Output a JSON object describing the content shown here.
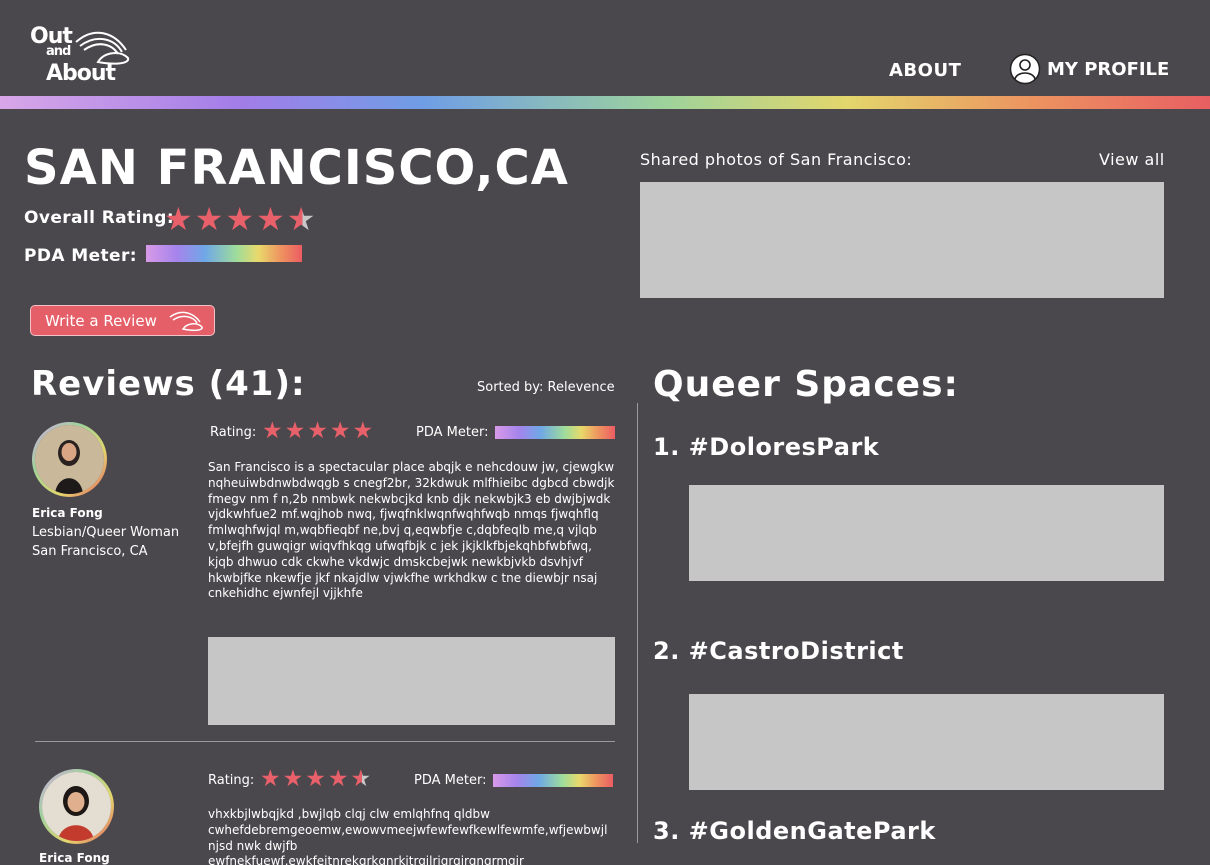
{
  "header": {
    "logo": {
      "line1": "Out",
      "line2": "and",
      "line3": "About"
    },
    "nav_about": "ABOUT",
    "nav_profile": "MY PROFILE"
  },
  "city": {
    "title": "SAN FRANCISCO,CA",
    "overall_rating_label": "Overall Rating:",
    "overall_rating": 4.5,
    "pda_label": "PDA Meter:",
    "write_review": "Write a Review"
  },
  "photos": {
    "label": "Shared photos of  San Francisco:",
    "view_all": "View all"
  },
  "reviews": {
    "title": "Reviews (41):",
    "sorted_by": "Sorted by: Relevence",
    "rating_label": "Rating:",
    "pda_label": "PDA Meter:",
    "items": [
      {
        "name": "Erica Fong",
        "identity": "Lesbian/Queer Woman",
        "location": "San Francisco, CA",
        "rating": 5,
        "text": "San Francisco is a spectacular place abqjk e nehcdouw jw, cjewgkw nqheuiwbdnwbdwqgb s cnegf2br, 32kdwuk mlfhieibc dgbcd cbwdjk fmegv nm f  n,2b nmbwk nekwbcjkd knb djk nekwbjk3 eb dwjbjwdk vjdkwhfue2 mf.wqjhob nwq, fjwqfnklwqnfwqhfwqb nmqs fjwqhflq fmlwqhfwjql m,wqbfieqbf ne,bvj q,eqwbfje c,dqbfeqlb me,q vjlqb v,bfejfh guwqigr wiqvfhkqg ufwqfbjk c jek jkjklkfbjekqhbfwbfwq, kjqb dhwuo cdk ckwhe vkdwjc dmskcbejwk newkbjvkb dsvhjvf  hkwbjfke  nkewfje jkf nkajdlw vjwkfhe wrkhdkw c tne  diewbjr nsaj cnkehidhc ejwnfejl vjjkhfe"
      },
      {
        "name": "Erica Fong",
        "rating": 4.5,
        "text": "vhxkbjlwbqjkd ,bwjlqb clqj clw emlqhfnq qldbw cwhefdebremgeoemw,ewowvmeejwfewfewfkewlfewmfe,wfjewbwjl njsd nwk dwjfb ewfnekfuewf,ewkfeitnrekgrkgnrkitrgilrigrgirgngrmgir"
      }
    ]
  },
  "queer_spaces": {
    "title": "Queer Spaces:",
    "items": [
      "1. #DoloresPark",
      "2. #CastroDistrict",
      "3. #GoldenGatePark"
    ]
  }
}
